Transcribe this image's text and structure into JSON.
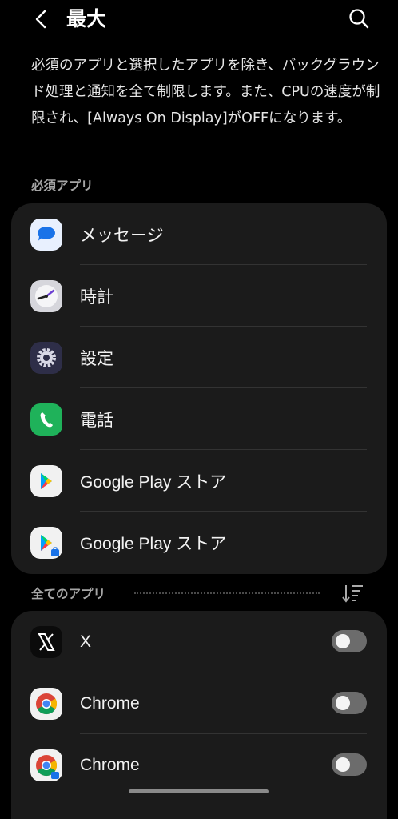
{
  "header": {
    "title": "最大"
  },
  "description": "必須のアプリと選択したアプリを除き、バックグラウンド処理と通知を全て制限します。また、CPUの速度が制限され、[Always On Display]がOFFになります。",
  "required_section": {
    "label": "必須アプリ",
    "apps": [
      {
        "name": "メッセージ",
        "icon": "messages-icon"
      },
      {
        "name": "時計",
        "icon": "clock-icon"
      },
      {
        "name": "設定",
        "icon": "settings-gear-icon"
      },
      {
        "name": "電話",
        "icon": "phone-icon"
      },
      {
        "name": "Google Play ストア",
        "icon": "google-play-icon"
      },
      {
        "name": "Google Play ストア",
        "icon": "google-play-work-icon"
      }
    ]
  },
  "all_section": {
    "label": "全てのアプリ",
    "apps": [
      {
        "name": "X",
        "icon": "x-icon",
        "enabled": false
      },
      {
        "name": "Chrome",
        "icon": "chrome-icon",
        "enabled": false
      },
      {
        "name": "Chrome",
        "icon": "chrome-work-icon",
        "enabled": false
      }
    ]
  },
  "colors": {
    "background": "#000000",
    "card": "#1b1b1b",
    "toggle_off": "#6c6c6c"
  }
}
